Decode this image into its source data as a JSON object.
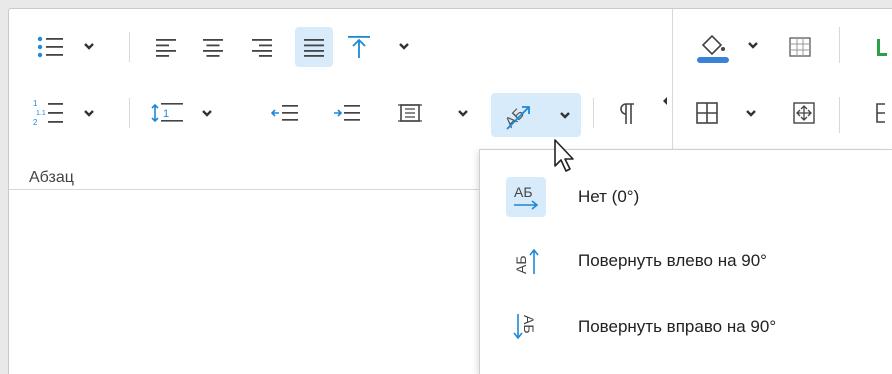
{
  "group": {
    "label": "Абзац"
  },
  "toolbar": {
    "row1": [
      {
        "name": "bullet-list-icon"
      },
      {
        "name": "align-left-icon"
      },
      {
        "name": "align-center-icon"
      },
      {
        "name": "align-right-icon"
      },
      {
        "name": "justify-icon",
        "selected": true
      },
      {
        "name": "vertical-align-top-icon"
      },
      {
        "name": "fill-color-icon"
      },
      {
        "name": "table-style-icon"
      }
    ],
    "row2": [
      {
        "name": "multilevel-list-icon"
      },
      {
        "name": "line-spacing-icon"
      },
      {
        "name": "decrease-indent-icon"
      },
      {
        "name": "increase-indent-icon"
      },
      {
        "name": "cell-margins-icon"
      },
      {
        "name": "text-direction-icon",
        "selected": true
      },
      {
        "name": "pilcrow-icon"
      },
      {
        "name": "borders-icon"
      },
      {
        "name": "table-align-icon"
      }
    ]
  },
  "menu": {
    "items": [
      {
        "label": "Нет (0°)",
        "icon_text": "АБ",
        "icon": "text-direction-none-icon",
        "selected": true
      },
      {
        "label": "Повернуть влево на 90°",
        "icon_text": "АБ",
        "icon": "rotate-left-90-icon",
        "selected": false
      },
      {
        "label": "Повернуть вправо на 90°",
        "icon_text": "АБ",
        "icon": "rotate-right-90-icon",
        "selected": false
      }
    ]
  },
  "colors": {
    "accent": "#1e88d8",
    "icon": "#444444",
    "selected_bg": "#d7ebfb",
    "fill_swatch": "#3b82d6",
    "green_fragment": "#2e9e4a"
  }
}
